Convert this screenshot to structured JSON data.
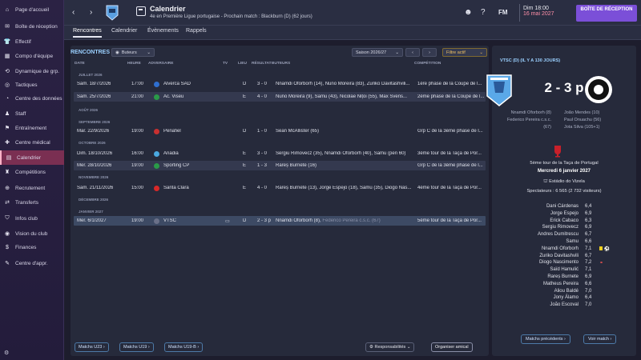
{
  "sidebar": {
    "items": [
      {
        "label": "Page d'accueil",
        "icon": "home-icon"
      },
      {
        "label": "Boîte de réception",
        "icon": "inbox-icon"
      },
      {
        "label": "Effectif",
        "icon": "squad-icon"
      },
      {
        "label": "Compo d'équipe",
        "icon": "tactics-board-icon"
      },
      {
        "label": "Dynamique de grp.",
        "icon": "dynamics-icon"
      },
      {
        "label": "Tactiques",
        "icon": "tactics-icon"
      },
      {
        "label": "Centre des données",
        "icon": "data-icon"
      },
      {
        "label": "Staff",
        "icon": "staff-icon"
      },
      {
        "label": "Entraînement",
        "icon": "training-icon"
      },
      {
        "label": "Centre médical",
        "icon": "medical-icon"
      },
      {
        "label": "Calendrier",
        "icon": "calendar-icon"
      },
      {
        "label": "Compétitions",
        "icon": "trophy-icon"
      },
      {
        "label": "Recrutement",
        "icon": "scouting-icon"
      },
      {
        "label": "Transferts",
        "icon": "transfers-icon"
      },
      {
        "label": "Infos club",
        "icon": "club-info-icon"
      },
      {
        "label": "Vision du club",
        "icon": "vision-icon"
      },
      {
        "label": "Finances",
        "icon": "finances-icon"
      },
      {
        "label": "Centre d'appr.",
        "icon": "academy-icon"
      }
    ],
    "active_index": 10,
    "help_label": "⚙"
  },
  "header": {
    "title": "Calendrier",
    "subtitle": "4e en Première Ligue portugaise - Prochain match : Blackburn (D) (62 jours)",
    "date_line1": "Dim 18:00",
    "date_line2": "16 mai 2027",
    "inbox_button": "BOÎTE DE RÉCEPTION",
    "fm_label": "FM"
  },
  "tabs": [
    "Rencontres",
    "Calendrier",
    "Évènements",
    "Rappels"
  ],
  "main": {
    "section_title": "RENCONTRES",
    "buteurs_label": "Buteurs",
    "season_label": "Saison 2026/27",
    "filter_label": "Filtre actif",
    "columns": [
      "DATE",
      "HEURE",
      "ADVERSAIRE",
      "TV",
      "LIEU",
      "RÉSULTAT",
      "BUTEURS",
      "COMPÉTITION"
    ],
    "months": [
      "JUILLET 2026",
      "AOÛT 2026",
      "SEPTEMBRE 2026",
      "OCTOBRE 2026",
      "NOVEMBRE 2026",
      "DÉCEMBRE 2026",
      "JANVIER 2027"
    ],
    "matches": [
      {
        "date": "Sam. 18/7/2026",
        "time": "17:00",
        "opp": "Alverca SAD",
        "venue": "D",
        "result": "3 - 0",
        "scorers": "Nnamdi Oforborh (14), Nuno Moreira (83), Zuriko Davitashvili...",
        "comp": "1ère phase de la Coupe de l..."
      },
      {
        "date": "Sam. 25/7/2026",
        "time": "21:00",
        "opp": "Ac. Viseu",
        "venue": "E",
        "result": "4 - 0",
        "scorers": "Nuno Moreira (9), Samu (43), Nicolae Nițoi (55), Max Svens...",
        "comp": "2ème phase de la Coupe de l..."
      },
      {
        "date": "Mar. 22/9/2026",
        "time": "19:00",
        "opp": "Penafiel",
        "venue": "D",
        "result": "1 - 0",
        "scorers": "Sean McAllister (65)",
        "comp": "Grp C de la 3ème phase de l..."
      },
      {
        "date": "Dim. 18/10/2026",
        "time": "16:00",
        "opp": "Anadia",
        "venue": "E",
        "result": "3 - 0",
        "scorers": "Sergiu Rimovecz (35), Nnamdi Oforborh (40), Samu (pen 60)",
        "comp": "3ème tour de la Taça de Por..."
      },
      {
        "date": "Mer. 28/10/2026",
        "time": "19:00",
        "opp": "Sporting CP",
        "venue": "E",
        "result": "1 - 3",
        "scorers": "Rareș Burnete (16)",
        "comp": "Grp C de la 3ème phase de l..."
      },
      {
        "date": "Sam. 21/11/2026",
        "time": "15:00",
        "opp": "Santa Clara",
        "venue": "E",
        "result": "4 - 0",
        "scorers": "Rareș Burnete (13), Jorge Espejo (18), Samu (35), Diogo Nas...",
        "comp": "4ème tour de la Taça de Por..."
      },
      {
        "date": "Mer. 6/1/2027",
        "time": "19:00",
        "opp": "VTSC",
        "venue": "D",
        "result": "2 - 3 p",
        "scorers": "Nnamdi Oforborh (8),",
        "scorers_b": "Federico Pereira c.s.c. (67)",
        "comp": "5ème tour de la Taça de Por..."
      }
    ],
    "bottom_buttons": [
      "Matchs U23",
      "Matchs U19",
      "Matchs U19-B"
    ],
    "resp_label": "Responsabilités",
    "organise_label": "Organiser amical"
  },
  "panel": {
    "header": "VTSC (D) (IL Y A 130 JOURS)",
    "score": "2 - 3 p",
    "home_scorers": [
      "Nnamdi Oforborh (8)",
      "Federico Pereira c.s.c.",
      "(67)"
    ],
    "away_scorers": [
      "João Mendes (10)",
      "Paul Onuachu (56)",
      "Jota Silva (105+1)"
    ],
    "competition": "5ème tour de la Taça de Portugal",
    "date": "Mercredi 6 janvier 2027",
    "stadium": "Estádio do Vizela",
    "attendance": "Spectateurs : 6 565 (2 732 visiteurs)",
    "ratings": [
      {
        "name": "Dani Cárdenas",
        "r": "6,4"
      },
      {
        "name": "Jorge Espejo",
        "r": "6,9"
      },
      {
        "name": "Erick Cabaco",
        "r": "6,3"
      },
      {
        "name": "Sergiu Rimovecz",
        "r": "6,9"
      },
      {
        "name": "Andres Dumitrescu",
        "r": "6,7"
      },
      {
        "name": "Samu",
        "r": "6,6"
      },
      {
        "name": "Nnamdi Oforborh",
        "r": "7,1"
      },
      {
        "name": "Zuriko Davitashvili",
        "r": "6,7"
      },
      {
        "name": "Diogo Nascimento",
        "r": "7,2"
      },
      {
        "name": "Saïd Hamulić",
        "r": "7,1"
      },
      {
        "name": "Rareș Burnete",
        "r": "6,9"
      },
      {
        "name": "Matheus Pereira",
        "r": "6,6"
      },
      {
        "name": "Aliou Baldé",
        "r": "7,0"
      },
      {
        "name": "Jony Álamo",
        "r": "6,4"
      },
      {
        "name": "João Escoval",
        "r": "7,0"
      }
    ],
    "prev_button": "Matchs précédents",
    "view_button": "Voir match"
  }
}
